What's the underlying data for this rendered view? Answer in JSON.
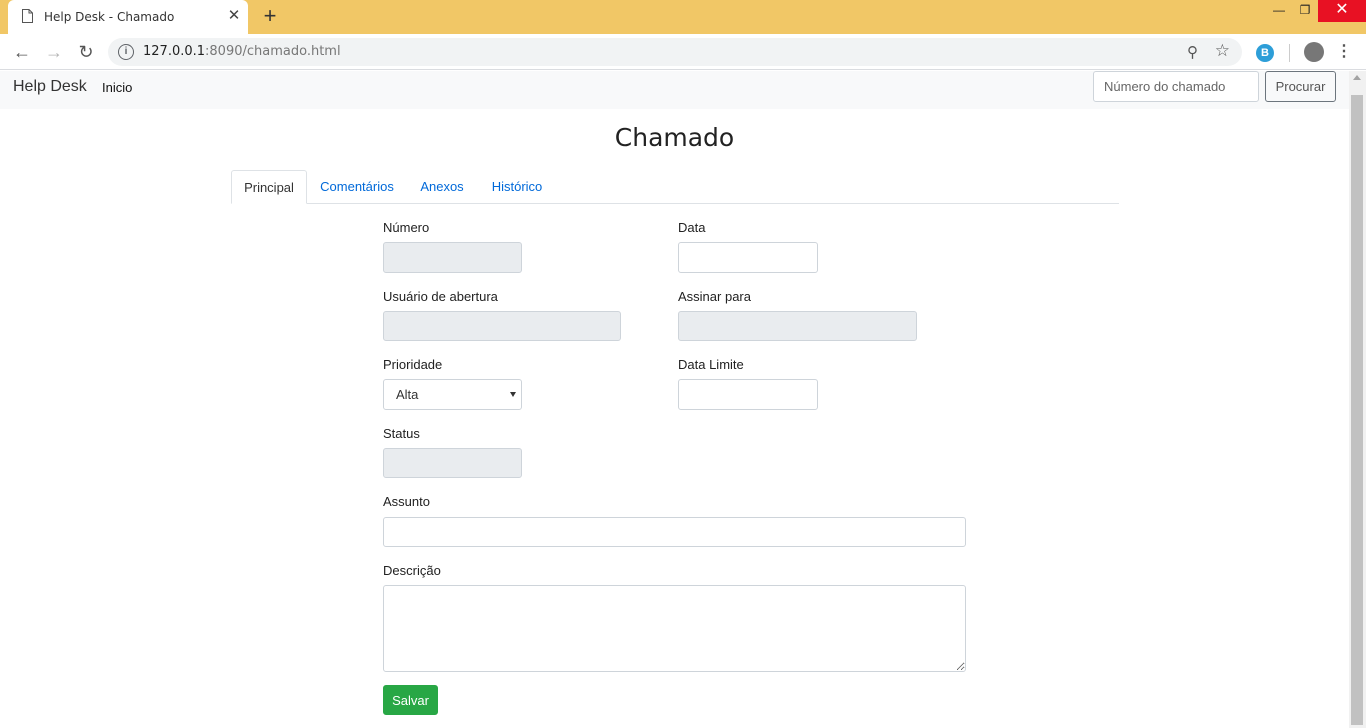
{
  "browser": {
    "tab_title": "Help Desk - Chamado",
    "url_host": "127.0.0.1",
    "url_rest": ":8090/chamado.html",
    "ext_letter": "B"
  },
  "navbar": {
    "brand": "Help Desk",
    "link_inicio": "Inicio",
    "search_placeholder": "Número do chamado",
    "search_button": "Procurar"
  },
  "page": {
    "title": "Chamado",
    "tabs": [
      {
        "label": "Principal",
        "active": true
      },
      {
        "label": "Comentários",
        "active": false
      },
      {
        "label": "Anexos",
        "active": false
      },
      {
        "label": "Histórico",
        "active": false
      }
    ]
  },
  "form": {
    "numero_label": "Número",
    "data_label": "Data",
    "usuario_label": "Usuário de abertura",
    "assinar_label": "Assinar para",
    "prioridade_label": "Prioridade",
    "prioridade_value": "Alta",
    "data_limite_label": "Data Limite",
    "status_label": "Status",
    "assunto_label": "Assunto",
    "descricao_label": "Descrição",
    "save_button": "Salvar"
  },
  "colors": {
    "tabstrip": "#f1c766",
    "primary_link": "#0069d9",
    "save_green": "#28a745",
    "readonly_bg": "#e9ecef"
  }
}
